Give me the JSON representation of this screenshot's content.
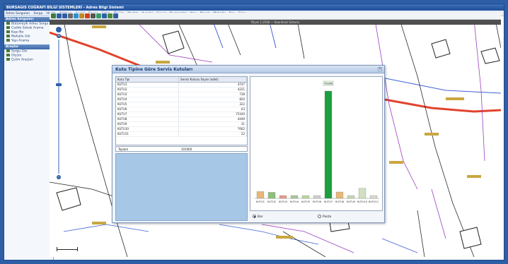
{
  "app": {
    "title": "BURSAGIS COĞRAFİ BİLGİ SİSTEMLERİ - Adres Bilgi Sistemi"
  },
  "menu": [
    "Adres Sorguları",
    "Sorgu",
    "Harita",
    "Katman",
    "Analiz",
    "Rapor",
    "Çizim",
    "Ölçüm",
    "Yardım",
    "Ayarlar",
    "Servis",
    "Numarataj",
    "Yapı",
    "Parsel",
    "Mahalle",
    "İlçe",
    "Çıkış"
  ],
  "toolbar": {
    "tools": [
      "pan-icon",
      "zoom-in-icon",
      "zoom-out-icon",
      "full-extent-icon",
      "info-icon",
      "measure-icon",
      "select-icon",
      "print-icon",
      "layers-icon",
      "search-icon",
      "refresh-icon",
      "help-icon"
    ]
  },
  "sidebar": {
    "panel1": "Adres Sorguları",
    "items1": [
      "Bütünleşik Adres Sorgu",
      "Cadde Sokak Arama",
      "Kapı No",
      "Mahalle Gör",
      "Yapı Arama"
    ],
    "panel2": "Araçlar",
    "items2": [
      "Sorgu Gör",
      "Ölçüm",
      "Çizim Araçları"
    ]
  },
  "map": {
    "banner": "Ölçek 1:2500 — Koordinat Sistemi"
  },
  "dialog": {
    "title": "Kutu Tipine Göre Servis Kutuları",
    "col1": "Kutu Tipi",
    "col2": "Servis Kutusu Sayısı (adet)",
    "rows": [
      [
        "KUTU1",
        "4747"
      ],
      [
        "KUTU2",
        "4221"
      ],
      [
        "KUTU3",
        "738"
      ],
      [
        "KUTU4",
        "820"
      ],
      [
        "KUTU5",
        "322"
      ],
      [
        "KUTU6",
        "63"
      ],
      [
        "KUTU7",
        "75160"
      ],
      [
        "KUTU8",
        "4449"
      ],
      [
        "KUTU9",
        "31"
      ],
      [
        "KUTU10",
        "7062"
      ],
      [
        "KUTU11",
        "22"
      ]
    ],
    "total_label": "Toplam",
    "total_value": "101900",
    "radio1": "Bar",
    "radio2": "Pasta"
  },
  "chart_data": {
    "type": "bar",
    "categories": [
      "KUTU1",
      "KUTU2",
      "KUTU3",
      "KUTU4",
      "KUTU5",
      "KUTU6",
      "KUTU7",
      "KUTU8",
      "KUTU9",
      "KUTU10",
      "KUTU11"
    ],
    "values": [
      4747,
      4221,
      738,
      820,
      322,
      63,
      75160,
      4449,
      31,
      7062,
      22
    ],
    "colors": [
      "#e8b878",
      "#8cc07a",
      "#e89a8a",
      "#a6c8a0",
      "#b8d8a0",
      "#d0d0d0",
      "#1e9e3e",
      "#e8b878",
      "#c8d8b0",
      "#d0e0c0",
      "#d8dcd0"
    ],
    "bar_label": "75160"
  },
  "colors": {
    "accent": "#2e5fa6",
    "road_red": "#e2432c",
    "parcel": "#2a2a2a",
    "road_purple": "#9a3fbf",
    "road_blue": "#3f5fd6"
  }
}
